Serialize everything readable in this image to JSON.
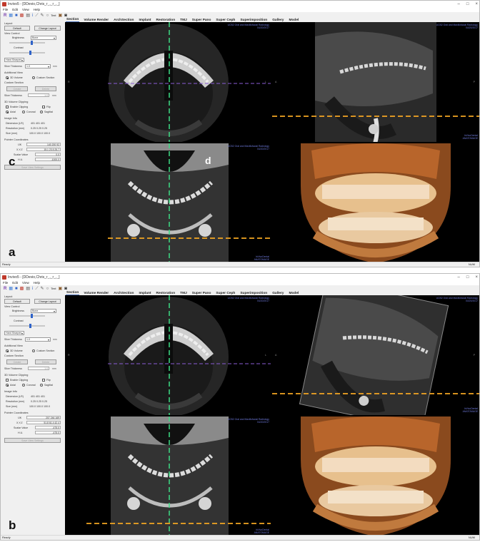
{
  "figure_labels": {
    "a": "a",
    "b": "b",
    "c": "c",
    "d": "d"
  },
  "app": {
    "title_a": "Invivo5 - [DDevio,Chris_r_,_r_,_]",
    "title_b": "Invivo5 - [DDevio,Chris_r_,_r_,_]",
    "window_controls": {
      "minimize": "–",
      "maximize": "□",
      "close": "×"
    },
    "menu": [
      "File",
      "Edit",
      "View",
      "Help"
    ],
    "toolbar_icons": [
      "app-logo-icon",
      "new-icon",
      "save-icon",
      "grid-icon",
      "report-icon",
      "info-icon",
      "measure-icon",
      "draw-icon",
      "circle-icon",
      "text-icon",
      "screenshot-icon",
      "camera-icon"
    ],
    "text_tool_label": "Text",
    "tabs": [
      "Section",
      "Volume Render",
      "ArchSection",
      "Implant",
      "Restoration",
      "TMJ",
      "Super Pano",
      "Super Ceph",
      "Superimposition",
      "Gallery",
      "Model"
    ],
    "active_tab": "Section",
    "status_left": "Ready",
    "status_right": "NUM"
  },
  "panel": {
    "layout_title": "Layout",
    "default_btn": "Default",
    "change_layout_btn": "Change Layout",
    "view_control_title": "View Control",
    "brightness_label": "Brightness",
    "brightness_value": "Bone",
    "contrast_label": "Contrast",
    "hard_sharpen_value": "Hard Sharpen",
    "slice_thickness_label": "Slice Thickness",
    "slice_thickness_value": "1.0",
    "mm": "mm",
    "additional_view_title": "Additional View",
    "opt_3d_volume": "3D Volume",
    "opt_custom_section": "Custom Section",
    "custom_section_title": "Custom Section",
    "create_btn": "Create",
    "delete_btn": "Delete",
    "slice_thickness2_value": "1.0",
    "clipping_title": "3D Volume Clipping",
    "enable_clipping": "Enable Clipping",
    "flip": "Flip",
    "axial": "Axial",
    "coronal": "Coronal",
    "sagittal": "Sagittal",
    "image_info_title": "Image Info",
    "dimension_label": "Dimension (LR)",
    "resolution_label": "Resolution (mm)",
    "size_label": "Size (mm)",
    "pointer_title": "Pointer Coordinates",
    "ijk_label": "IJK",
    "xyz_label": "X,Y,Z",
    "scalar_label": "Scalar Value",
    "hu_label": "H.U.",
    "save_view_btn": "Save View Settings"
  },
  "panel_values_a": {
    "dimension": "401  401  401",
    "resolution": "0.25  0.25  0.25",
    "size": "100.0  100.0  100.0",
    "ijk": "140  200  92",
    "xyz": "15.1  23.5  25.7",
    "scalar": "0.0",
    "hu": "-1000.0"
  },
  "panel_values_b": {
    "dimension": "401  401  401",
    "resolution": "0.25  0.25  0.25",
    "size": "100.0  100.0  100.0",
    "ijk": "207  246  169",
    "xyz": "51.8  61.4  42.4",
    "scalar": "-475.0",
    "hu": "-475.0"
  },
  "viewport_text": {
    "tl_corner": "Axial\nNo.\nSlice",
    "institution": "UCB2 Oral and Maxillofacial Radiology",
    "date": "04/20/2017",
    "software": "InVivoDental",
    "version": "ANATOMAGE",
    "orient_R": "R",
    "orient_L": "L",
    "orient_A": "A",
    "orient_P": "P",
    "orient_S": "S",
    "orient_I": "I"
  },
  "colors": {
    "dashed_green": "#3ddc84",
    "dashed_orange": "#f5a623",
    "dashed_purple": "#8a5cd6",
    "annotation_blue": "#6d78d8",
    "accent_blue": "#2f63c9"
  }
}
